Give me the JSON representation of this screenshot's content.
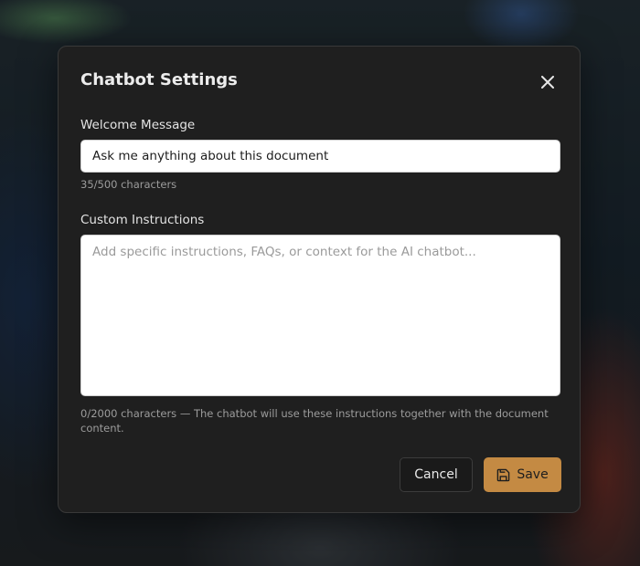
{
  "dialog": {
    "title": "Chatbot Settings",
    "close_icon": "close-icon"
  },
  "welcome": {
    "label": "Welcome Message",
    "value": "Ask me anything about this document",
    "char_count": "35/500 characters"
  },
  "instructions": {
    "label": "Custom Instructions",
    "value": "",
    "placeholder": "Add specific instructions, FAQs, or context for the AI chatbot...",
    "hint": "0/2000 characters — The chatbot will use these instructions together with the document content."
  },
  "actions": {
    "cancel_label": "Cancel",
    "save_label": "Save",
    "save_icon": "save-icon"
  },
  "colors": {
    "modal_bg": "#1f1f1f",
    "accent": "#c48a43"
  }
}
